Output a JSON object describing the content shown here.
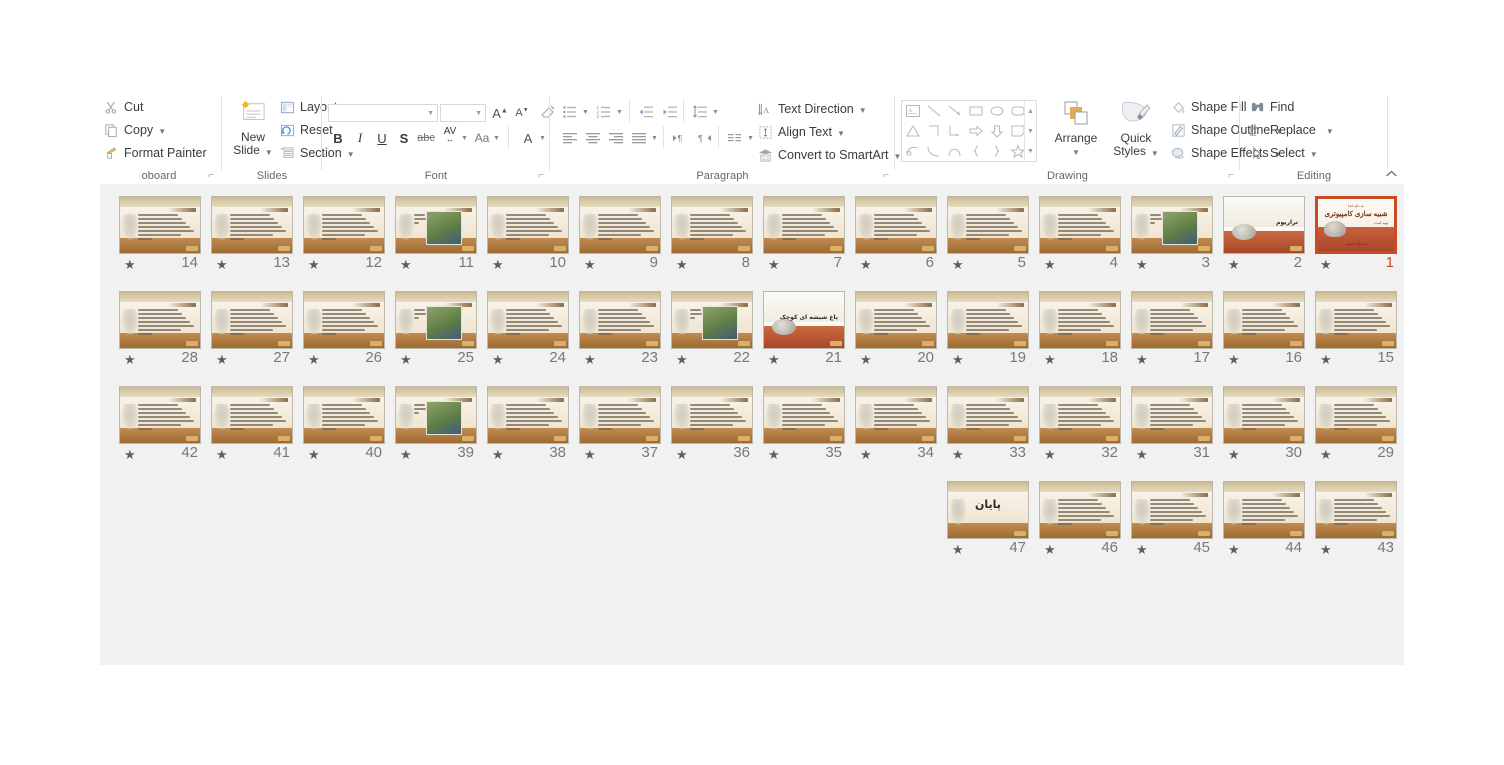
{
  "ribbon": {
    "groups": [
      {
        "name": "Clipboard",
        "label": "oboard"
      },
      {
        "name": "Slides",
        "label": "Slides"
      },
      {
        "name": "Font",
        "label": "Font"
      },
      {
        "name": "Paragraph",
        "label": "Paragraph"
      },
      {
        "name": "Drawing",
        "label": "Drawing"
      },
      {
        "name": "Editing",
        "label": "Editing"
      }
    ],
    "clipboard": {
      "cut": "Cut",
      "copy": "Copy",
      "format_painter": "Format Painter",
      "label": "oboard"
    },
    "slides": {
      "new_slide_line1": "New",
      "new_slide_line2": "Slide",
      "layout": "Layout",
      "reset": "Reset",
      "section": "Section",
      "label": "Slides"
    },
    "font": {
      "font_name_value": "",
      "font_size_value": "",
      "grow_font": "A",
      "shrink_font": "A",
      "clear_formatting": "clear-formatting",
      "bold": "B",
      "italic": "I",
      "underline": "U",
      "shadow": "S",
      "strikethrough": "abc",
      "character_spacing": "AV",
      "change_case": "Aa",
      "font_color": "A",
      "label": "Font"
    },
    "paragraph": {
      "text_direction": "Text Direction",
      "align_text": "Align Text",
      "convert_to_smartart": "Convert to SmartArt",
      "label": "Paragraph"
    },
    "drawing": {
      "arrange": "Arrange",
      "quick_styles_line1": "Quick",
      "quick_styles_line2": "Styles",
      "shape_fill": "Shape Fill",
      "shape_outline": "Shape Outline",
      "shape_effects": "Shape Effects",
      "label": "Drawing"
    },
    "editing": {
      "find": "Find",
      "replace": "Replace",
      "select": "Select",
      "label": "Editing"
    },
    "collapse_ribbon": "collapse-ribbon-icon"
  },
  "slide_sorter": {
    "selected_slide": 1,
    "total_slides": 47,
    "animation_star": "★",
    "rows": [
      {
        "slides": [
          14,
          13,
          12,
          11,
          10,
          9,
          8,
          7,
          6,
          5,
          4,
          3,
          2,
          1
        ]
      },
      {
        "slides": [
          28,
          27,
          26,
          25,
          24,
          23,
          22,
          21,
          20,
          19,
          18,
          17,
          16,
          15
        ]
      },
      {
        "slides": [
          42,
          41,
          40,
          39,
          38,
          37,
          36,
          35,
          34,
          33,
          32,
          31,
          30,
          29
        ]
      },
      {
        "slides": [
          47,
          46,
          45,
          44,
          43
        ]
      }
    ],
    "slide_kinds": {
      "1": "cover",
      "2": "photo-caption",
      "3": "photo",
      "4": "text",
      "5": "text",
      "6": "text",
      "7": "text",
      "8": "text",
      "9": "text",
      "10": "text",
      "11": "photo",
      "12": "text",
      "13": "text",
      "14": "text",
      "15": "text",
      "16": "text",
      "17": "text",
      "18": "text",
      "19": "text",
      "20": "text",
      "21": "photo-caption",
      "22": "photo",
      "23": "text",
      "24": "text",
      "25": "photo",
      "26": "text",
      "27": "text",
      "28": "text",
      "29": "text",
      "30": "text",
      "31": "text",
      "32": "text",
      "33": "text",
      "34": "text",
      "35": "text",
      "36": "text",
      "37": "text",
      "38": "text",
      "39": "photo",
      "40": "text",
      "41": "text",
      "42": "text",
      "43": "text",
      "44": "text",
      "45": "text",
      "46": "text",
      "47": "end"
    },
    "slide_text": {
      "cover_kicker": "به نام خدا",
      "cover_title": "شبیه سازی کامپیوتری",
      "cover_sub": "تهیه کننده",
      "cover_footer": "دانشگاه صنعتی",
      "caption_2": "تراریوم",
      "caption_21": "باغ شیشه ای کوچک",
      "end_title": "پایان"
    },
    "colors": {
      "selection": "#c94a25",
      "panel_bg": "#f1f1f1",
      "thumb_border": "#bdb7a8",
      "number": "#787878"
    }
  }
}
